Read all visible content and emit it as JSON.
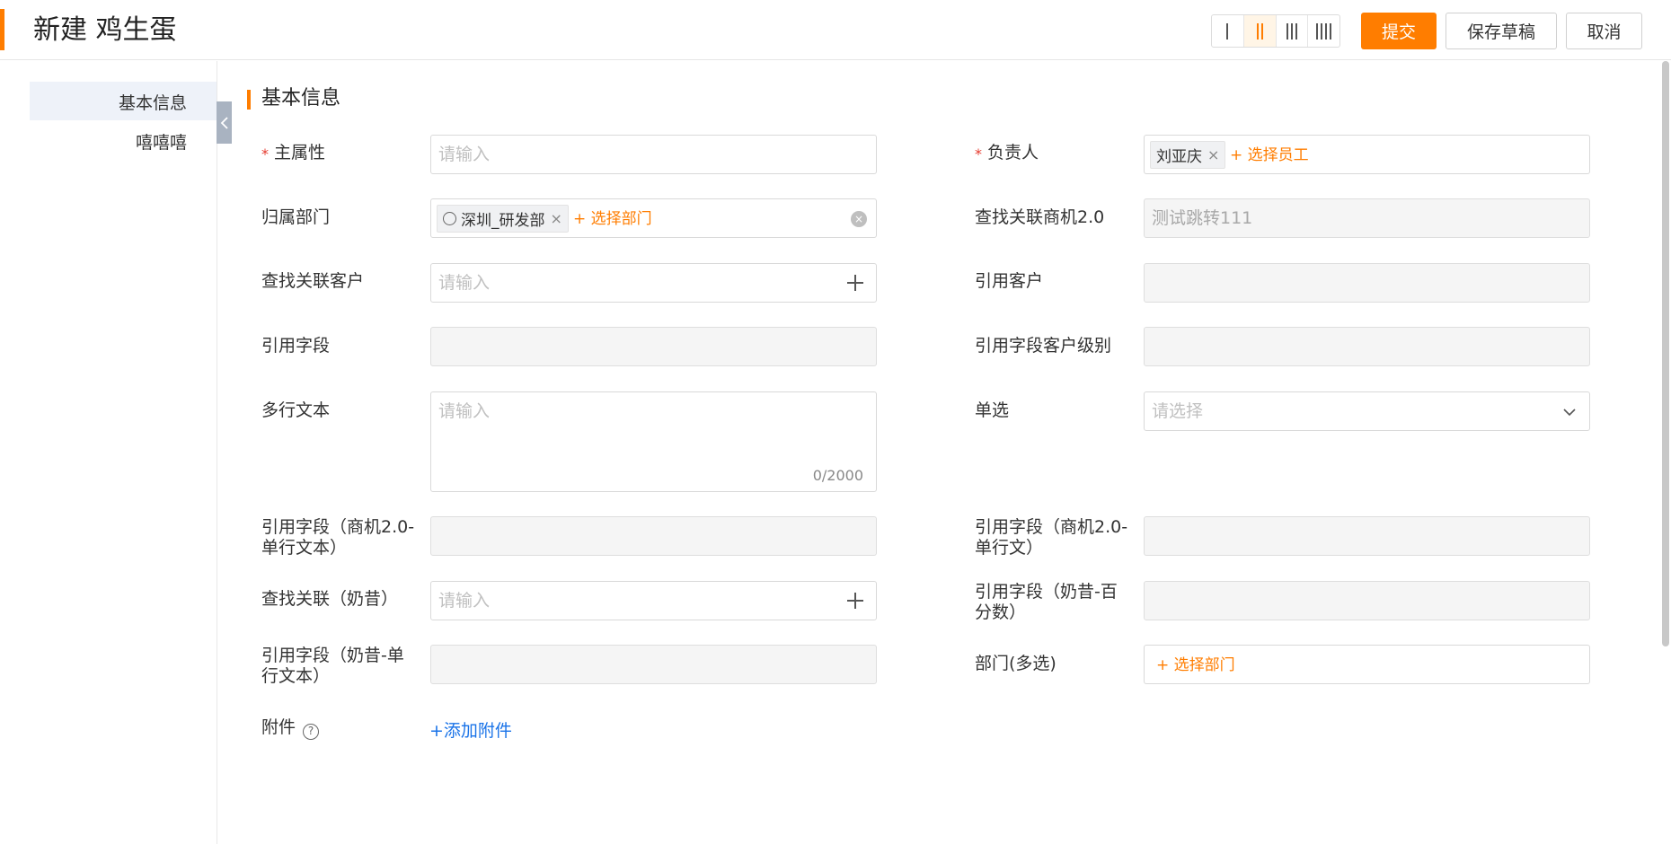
{
  "header": {
    "title": "新建 鸡生蛋",
    "submit_label": "提交",
    "draft_label": "保存草稿",
    "cancel_label": "取消",
    "accent_color": "#ff7d00"
  },
  "sidebar": {
    "items": [
      {
        "label": "基本信息"
      },
      {
        "label": "嘻嘻嘻"
      }
    ]
  },
  "section": {
    "title": "基本信息"
  },
  "fields": {
    "zhushuxing": {
      "label": "主属性",
      "placeholder": "请输入"
    },
    "fuzeren": {
      "label": "负责人",
      "tag": "刘亚庆",
      "action": "+ 选择员工"
    },
    "guishubumen": {
      "label": "归属部门",
      "tag": "深圳_研发部",
      "action": "+ 选择部门"
    },
    "chazhaoshangji": {
      "label": "查找关联商机2.0",
      "value": "测试跳转111"
    },
    "chazhaokehu": {
      "label": "查找关联客户",
      "placeholder": "请输入"
    },
    "yinyongkehu": {
      "label": "引用客户"
    },
    "yinyongziduan": {
      "label": "引用字段"
    },
    "yinyongjibie": {
      "label": "引用字段客户级别"
    },
    "duohangwenben": {
      "label": "多行文本",
      "placeholder": "请输入",
      "counter": "0/2000"
    },
    "danxuan": {
      "label": "单选",
      "placeholder": "请选择"
    },
    "yinyong_shangji_danhang": {
      "label_line1": "引用字段（商机2.0-",
      "label_line2": "单行文本）"
    },
    "yinyong_shangji_danhangwen": {
      "label_line1": "引用字段（商机2.0-",
      "label_line2": "单行文）"
    },
    "chazhao_naixi": {
      "label": "查找关联（奶昔）",
      "placeholder": "请输入"
    },
    "yinyong_naixi_baifenshu": {
      "label_line1": "引用字段（奶昔-百",
      "label_line2": "分数）"
    },
    "yinyong_naixi_danhang": {
      "label_line1": "引用字段（奶昔-单",
      "label_line2": "行文本）"
    },
    "bumen_duoxuan": {
      "label": "部门(多选)",
      "action": "+ 选择部门"
    },
    "fujian": {
      "label": "附件",
      "help": "?",
      "action": "+添加附件"
    }
  }
}
